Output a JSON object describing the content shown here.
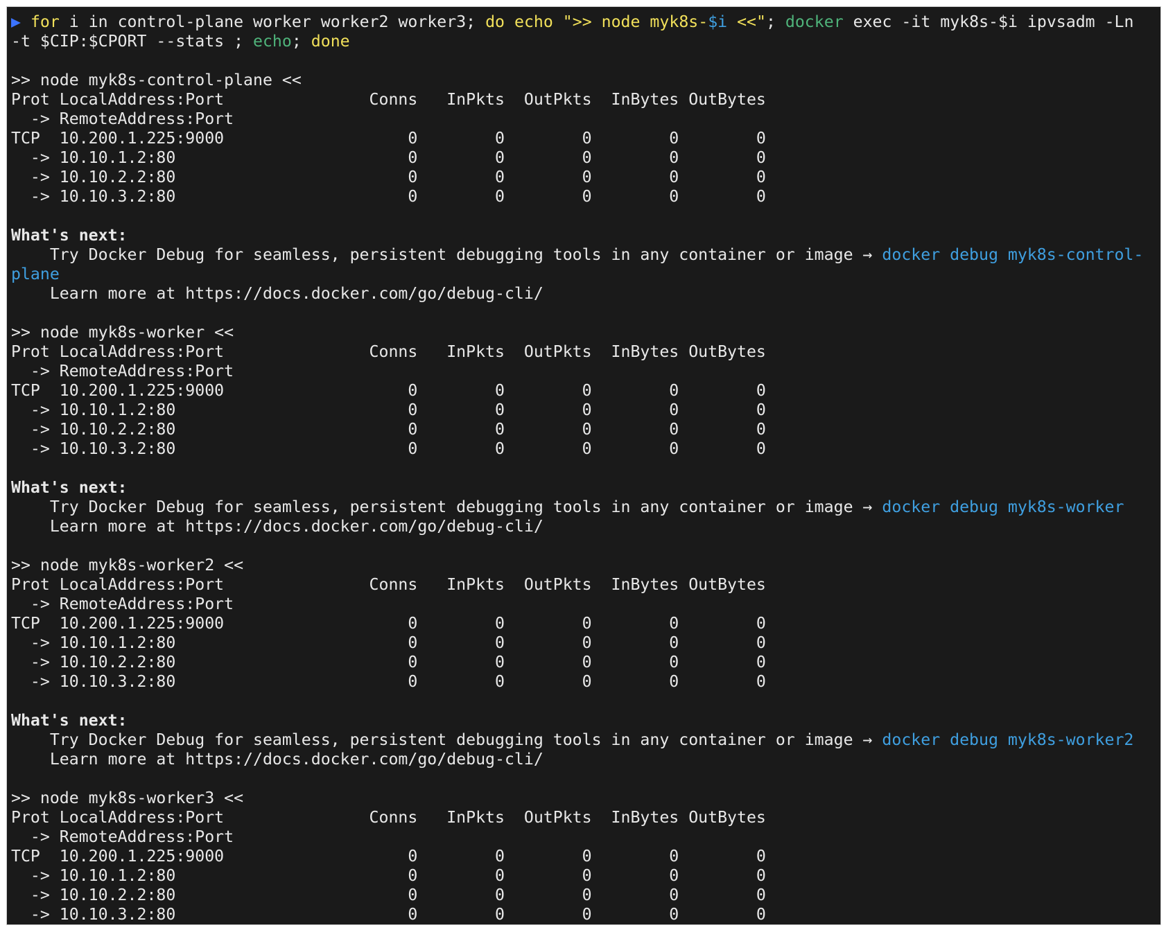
{
  "command": {
    "prompt_symbol": "▶",
    "kw_for": "for",
    "loop_var": " i ",
    "kw_in": "in",
    "node_list": " control-plane worker worker2 worker3; ",
    "kw_do": "do",
    "space1": " ",
    "echo1": "echo",
    "space2": " ",
    "echo_arg_open": "\">> node myk8s-",
    "echo_var": "$i",
    "echo_arg_close": " <<\"",
    "sep1": "; ",
    "docker": "docker",
    "exec_args": " exec -it myk8s-$i ipvsadm -Ln",
    "line2_args": "-t $CIP:$CPORT --stats ; ",
    "echo2": "echo",
    "sep2": "; ",
    "kw_done": "done"
  },
  "table": {
    "header": "Prot LocalAddress:Port               Conns   InPkts  OutPkts  InBytes OutBytes",
    "subheader": "  -> RemoteAddress:Port"
  },
  "nodes": [
    {
      "title": ">> node myk8s-control-plane <<",
      "rows": [
        "TCP  10.200.1.225:9000                   0        0        0        0        0",
        "  -> 10.10.1.2:80                        0        0        0        0        0",
        "  -> 10.10.2.2:80                        0        0        0        0        0",
        "  -> 10.10.3.2:80                        0        0        0        0        0"
      ],
      "next_heading": "What's next:",
      "debug_text": "    Try Docker Debug for seamless, persistent debugging tools in any container or image → ",
      "debug_cmd_a": "docker debug myk8s-control-",
      "debug_cmd_b": "plane",
      "learn_more": "    Learn more at https://docs.docker.com/go/debug-cli/"
    },
    {
      "title": ">> node myk8s-worker <<",
      "rows": [
        "TCP  10.200.1.225:9000                   0        0        0        0        0",
        "  -> 10.10.1.2:80                        0        0        0        0        0",
        "  -> 10.10.2.2:80                        0        0        0        0        0",
        "  -> 10.10.3.2:80                        0        0        0        0        0"
      ],
      "next_heading": "What's next:",
      "debug_text": "    Try Docker Debug for seamless, persistent debugging tools in any container or image → ",
      "debug_cmd": "docker debug myk8s-worker",
      "learn_more": "    Learn more at https://docs.docker.com/go/debug-cli/"
    },
    {
      "title": ">> node myk8s-worker2 <<",
      "rows": [
        "TCP  10.200.1.225:9000                   0        0        0        0        0",
        "  -> 10.10.1.2:80                        0        0        0        0        0",
        "  -> 10.10.2.2:80                        0        0        0        0        0",
        "  -> 10.10.3.2:80                        0        0        0        0        0"
      ],
      "next_heading": "What's next:",
      "debug_text": "    Try Docker Debug for seamless, persistent debugging tools in any container or image → ",
      "debug_cmd": "docker debug myk8s-worker2",
      "learn_more": "    Learn more at https://docs.docker.com/go/debug-cli/"
    },
    {
      "title": ">> node myk8s-worker3 <<",
      "rows": [
        "TCP  10.200.1.225:9000                   0        0        0        0        0",
        "  -> 10.10.1.2:80                        0        0        0        0        0",
        "  -> 10.10.2.2:80                        0        0        0        0        0",
        "  -> 10.10.3.2:80                        0        0        0        0        0"
      ]
    }
  ],
  "colors": {
    "background": "#1a1a1a",
    "text": "#e8e8e8",
    "keyword_yellow": "#f1e05a",
    "command_green": "#4fb37a",
    "link_blue": "#3f9fe0",
    "prompt_blue": "#3b73ff"
  }
}
